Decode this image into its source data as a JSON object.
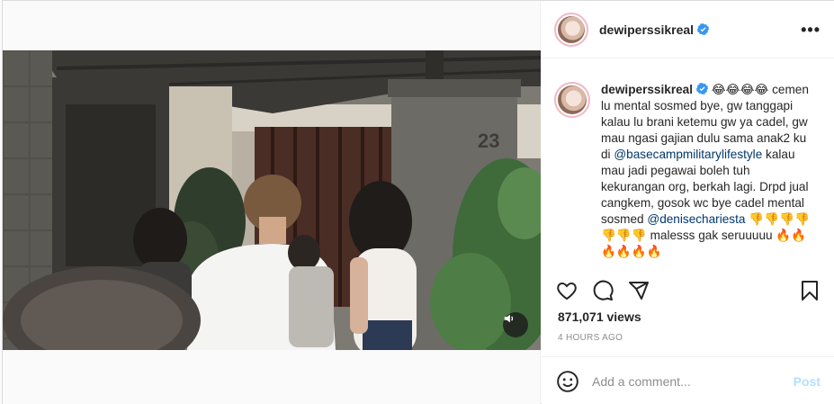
{
  "account": {
    "username": "dewiperssikreal",
    "verified": true
  },
  "header": {
    "more_label": "•••"
  },
  "caption": {
    "username": "dewiperssikreal",
    "emojis": "😂😂😂😂",
    "text_1": "cemen lu mental sosmed bye, gw tanggapi kalau lu brani ketemu gw ya cadel, gw mau ngasi gajian dulu sama anak2 ku di",
    "mention_1": "@basecampmilitarylifestyle",
    "text_2": "kalau mau jadi pegawai boleh tuh kekurangan org, berkah lagi. Drpd jual cangkem, gosok wc bye cadel mental sosmed",
    "mention_2": "@denisechariesta",
    "emojis_2": "👎👎👎👎👎👎👎",
    "text_3": "malesss gak seruuuuu",
    "emojis_3": "🔥🔥🔥🔥🔥🔥"
  },
  "video": {
    "house_number": "23",
    "muted_icon": "speaker-icon"
  },
  "stats": {
    "views": "871,071 views",
    "time": "4 HOURS AGO"
  },
  "comment": {
    "placeholder": "Add a comment...",
    "post_label": "Post"
  },
  "colors": {
    "border": "#dbdbdb",
    "link": "#00376b",
    "verified": "#3897f0",
    "post_disabled": "#b2dffc",
    "muted_text": "#8e8e8e"
  }
}
